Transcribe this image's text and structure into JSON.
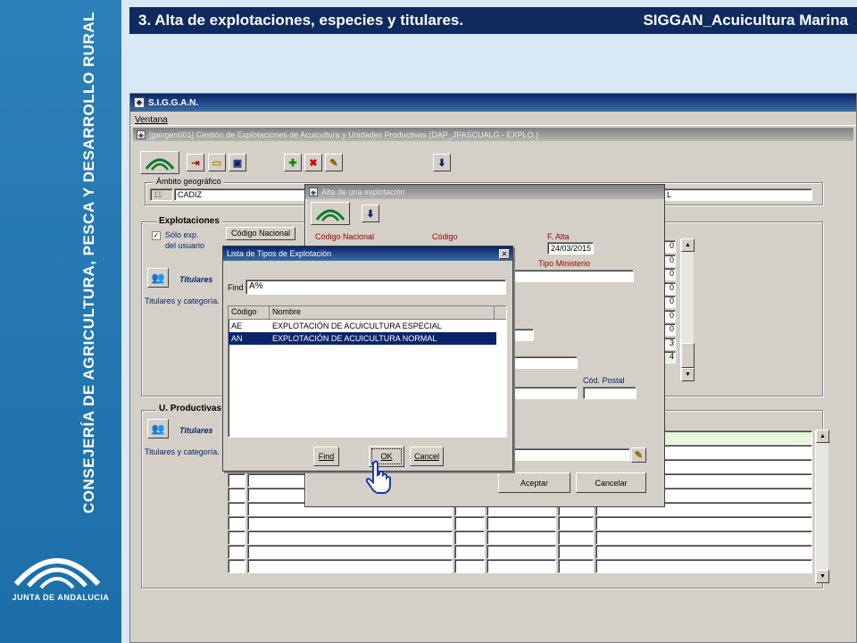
{
  "sidebar": {
    "vertical_text": "CONSEJERÍA DE AGRICULTURA, PESCA Y DESARROLLO RURAL",
    "logo_text": "JUNTA DE ANDALUCIA"
  },
  "header": {
    "left": "3. Alta de explotaciones, especies y titulares.",
    "right": "SIGGAN_Acuicultura Marina"
  },
  "app": {
    "title": "S.I.G.G.A.N.",
    "menu": "Ventana",
    "inner_title": "[gangen001] Gestión de Explotaciones de Acuicultura y Unidades Productivas (DAP_JPASCUALG - EXPLO.)",
    "ambito_label": "Ámbito geográfico",
    "ambito_code": "11",
    "ambito_name": "CADIZ",
    "ambito_right": "L",
    "explotaciones_label": "Explotaciones",
    "solo_exp": "Sólo exp.",
    "del_usuario": "del usuario",
    "codigo_nacional_btn": "Código Nacional",
    "titulares": "Titulares",
    "titulares_cat": "Titulares y categoría.",
    "up_label": "U. Productivas",
    "titulares2": "Titulares",
    "titulares_cat2": "Titulares y categoría.",
    "right_digits": [
      "0",
      "0",
      "0",
      "0",
      "0",
      "0",
      "0",
      "3",
      "4"
    ]
  },
  "alta": {
    "title": "Alta de una explotación",
    "codigo_nacional": "Código Nacional",
    "codigo": "Código",
    "f_alta_label": "F. Alta",
    "f_alta_value": "24/03/2015",
    "tipo_ministerio": "Tipo Ministerio",
    "cod_postal": "Cód. Postal",
    "aceptar": "Aceptar",
    "cancelar": "Cancelar"
  },
  "lista": {
    "title": "Lista de Tipos de Explotación",
    "find_label": "Find",
    "find_value": "A%",
    "columns": [
      "Código",
      "Nombre"
    ],
    "rows": [
      {
        "codigo": "AE",
        "nombre": "EXPLOTACIÓN DE ACUICULTURA ESPECIAL"
      },
      {
        "codigo": "AN",
        "nombre": "EXPLOTACIÓN DE ACUICULTURA NORMAL"
      }
    ],
    "selected_index": 1,
    "btn_find": "Find",
    "btn_ok": "OK",
    "btn_cancel": "Cancel"
  },
  "colors": {
    "sidebar": "#1c6ea8",
    "header_bg": "#0e2a5e",
    "background": "#d8e8f7",
    "window": "#d4d0c8",
    "titlebar": "#0a246a",
    "selection": "#0a246a"
  }
}
